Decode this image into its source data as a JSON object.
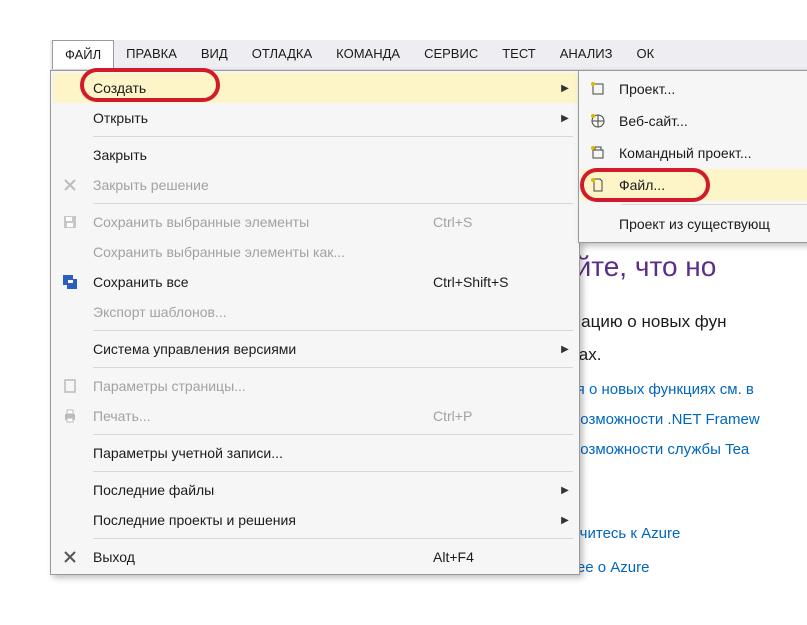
{
  "menubar": {
    "items": [
      {
        "label": "ФАЙЛ"
      },
      {
        "label": "ПРАВКА"
      },
      {
        "label": "ВИД"
      },
      {
        "label": "ОТЛАДКА"
      },
      {
        "label": "КОМАНДА"
      },
      {
        "label": "СЕРВИС"
      },
      {
        "label": "ТЕСТ"
      },
      {
        "label": "АНАЛИЗ"
      },
      {
        "label": "ОК"
      }
    ]
  },
  "file_menu": {
    "create": {
      "label": "Создать",
      "submenu": true,
      "highlight": true
    },
    "open": {
      "label": "Открыть",
      "submenu": true
    },
    "close": {
      "label": "Закрыть"
    },
    "close_solution": {
      "label": "Закрыть решение",
      "disabled": true
    },
    "save_selected": {
      "label": "Сохранить выбранные элементы",
      "shortcut": "Ctrl+S",
      "disabled": true
    },
    "save_selected_as": {
      "label": "Сохранить выбранные элементы как...",
      "disabled": true
    },
    "save_all": {
      "label": "Сохранить все",
      "shortcut": "Ctrl+Shift+S"
    },
    "export_templates": {
      "label": "Экспорт шаблонов...",
      "disabled": true
    },
    "source_control": {
      "label": "Система управления версиями",
      "submenu": true
    },
    "page_setup": {
      "label": "Параметры страницы...",
      "disabled": true
    },
    "print": {
      "label": "Печать...",
      "shortcut": "Ctrl+P",
      "disabled": true
    },
    "account_settings": {
      "label": "Параметры учетной записи..."
    },
    "recent_files": {
      "label": "Последние файлы",
      "submenu": true
    },
    "recent_projects": {
      "label": "Последние проекты и решения",
      "submenu": true
    },
    "exit": {
      "label": "Выход",
      "shortcut": "Alt+F4"
    }
  },
  "create_submenu": {
    "project": {
      "label": "Проект..."
    },
    "website": {
      "label": "Веб-сайт..."
    },
    "team_project": {
      "label": "Командный проект..."
    },
    "file": {
      "label": "Файл...",
      "highlight": true
    },
    "from_existing": {
      "label": "Проект из существующ"
    }
  },
  "background": {
    "heading_frag": "айте, что но",
    "line1": "рмацию о новых фун",
    "line2": "елах.",
    "link1": "ния о новых функциях см. в",
    "link2": "е возможности .NET Framew",
    "link3": "е возможности службы Tea",
    "azure1": "лючитесь к Azure",
    "azure2": "бнее о Azure"
  }
}
